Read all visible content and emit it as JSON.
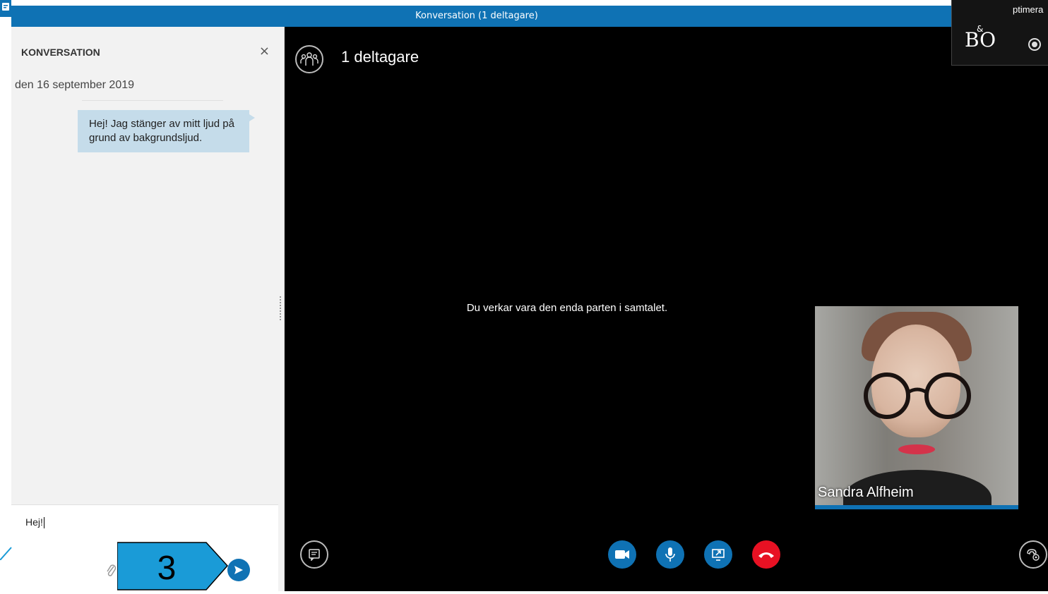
{
  "window": {
    "title": "Konversation (1 deltagare)"
  },
  "chat": {
    "header": "KONVERSATION",
    "close_label": "×",
    "date": "den 16 september 2019",
    "messages": [
      {
        "text": "Hej! Jag stänger av mitt ljud på grund av bakgrundsljud."
      }
    ],
    "compose_value": "Hej!"
  },
  "callout": {
    "number": "3"
  },
  "stage": {
    "participants_label": "1 deltagare",
    "solo_message": "Du verkar vara den enda parten i samtalet.",
    "video_name": "Sandra Alfheim"
  },
  "overlay": {
    "text": "ptimera",
    "logo": "BO",
    "logo_amp": "&"
  },
  "colors": {
    "accent": "#0f72b4",
    "hangup": "#e81123",
    "bubble": "#c5dcea"
  },
  "icons": {
    "participants": "participants-icon",
    "send": "send-icon",
    "attach": "paperclip-icon",
    "video": "video-camera-icon",
    "mic": "microphone-icon",
    "share": "share-screen-icon",
    "hangup": "hang-up-icon",
    "chat": "chat-icon",
    "devices": "call-devices-icon",
    "record": "record-icon"
  }
}
